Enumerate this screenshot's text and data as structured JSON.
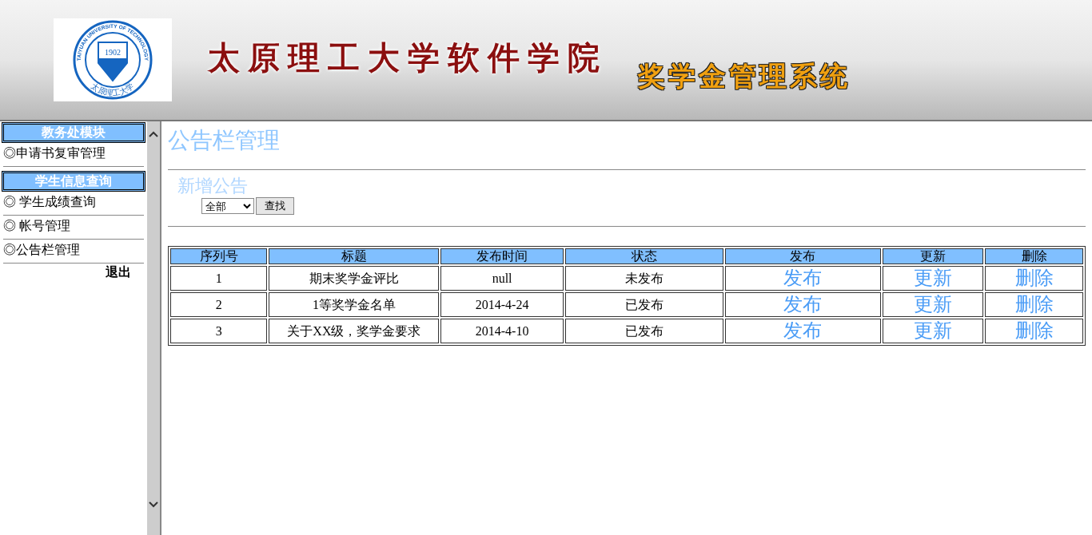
{
  "header": {
    "logo": {
      "ring_text": "TAIYUAN UNIVERSITY OF TECHNOLOGY",
      "year": "1902",
      "script_text": "太原理工大学"
    },
    "school_title": "太原理工大学软件学院",
    "system_title": "奖学金管理系统"
  },
  "sidebar": {
    "sections": [
      {
        "title": "教务处模块",
        "items": [
          {
            "label": "◎申请书复审管理"
          }
        ]
      },
      {
        "title": "学生信息查询",
        "items": [
          {
            "label": "◎ 学生成绩查询"
          },
          {
            "label": "◎ 帐号管理"
          },
          {
            "label": "◎公告栏管理"
          }
        ]
      }
    ],
    "logout": "退出"
  },
  "main": {
    "title": "公告栏管理",
    "add_link": "新增公告",
    "filter": {
      "value": "全部"
    },
    "search_button": "查找",
    "table": {
      "columns": [
        "序列号",
        "标题",
        "发布时间",
        "状态",
        "发布",
        "更新",
        "删除"
      ],
      "rows": [
        {
          "index": "1",
          "title": "期末奖学金评比",
          "time": "null",
          "status": "未发布",
          "actions": [
            "发布",
            "更新",
            "删除"
          ]
        },
        {
          "index": "2",
          "title": "1等奖学金名单",
          "time": "2014-4-24",
          "status": "已发布",
          "actions": [
            "发布",
            "更新",
            "删除"
          ]
        },
        {
          "index": "3",
          "title": "关于XX级，奖学金要求",
          "time": "2014-4-10",
          "status": "已发布",
          "actions": [
            "发布",
            "更新",
            "删除"
          ]
        }
      ]
    }
  }
}
